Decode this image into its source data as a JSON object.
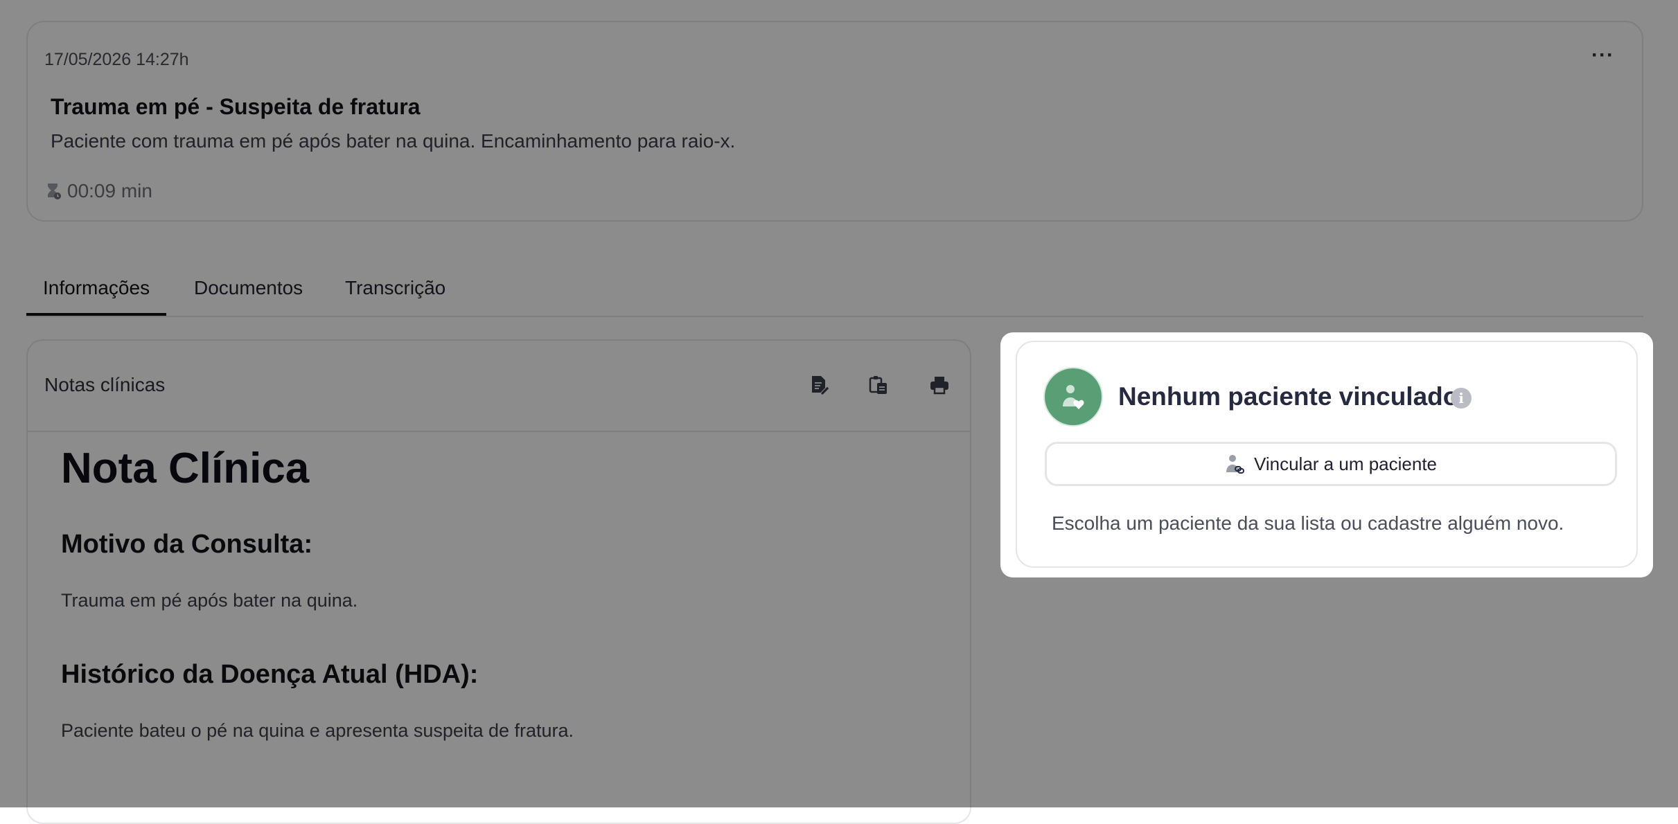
{
  "session": {
    "datetime": "17/05/2026 14:27h",
    "menu_label": "···",
    "title": "Trauma em pé - Suspeita de fratura",
    "description": "Paciente com trauma em pé após bater na quina. Encaminhamento para raio-x.",
    "duration": "00:09 min"
  },
  "tabs": [
    {
      "label": "Informações",
      "active": true
    },
    {
      "label": "Documentos",
      "active": false
    },
    {
      "label": "Transcrição",
      "active": false
    }
  ],
  "notes": {
    "panel_label": "Notas clínicas",
    "toolbar_icons": [
      "edit-document-icon",
      "copy-clipboard-icon",
      "print-icon"
    ],
    "document": {
      "title": "Nota Clínica",
      "sections": [
        {
          "heading": "Motivo da Consulta:",
          "body": "Trauma em pé após bater na quina."
        },
        {
          "heading": "Histórico da Doença Atual (HDA):",
          "body": "Paciente bateu o pé na quina e apresenta suspeita de fratura."
        }
      ]
    }
  },
  "patient_popup": {
    "title": "Nenhum paciente vinculado",
    "info_icon": "i",
    "link_button_label": "Vincular a um paciente",
    "help_text": "Escolha um paciente da sua lista ou cadastre alguém novo.",
    "avatar_color": "#5a9e76"
  },
  "colors": {
    "overlay": "rgba(0,0,0,0.45)",
    "border": "#e3e5ea",
    "accent_green": "#5a9e76"
  }
}
